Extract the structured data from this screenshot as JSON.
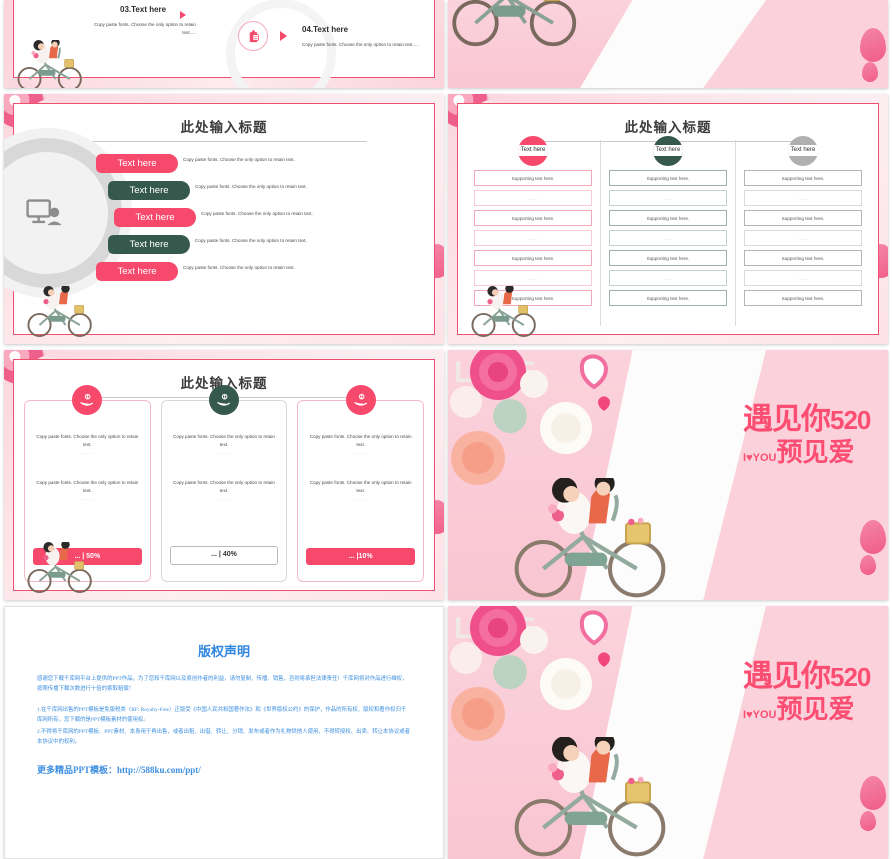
{
  "deck": {
    "theme_colors": {
      "pink": "#f7496c",
      "pink_light": "#fbd3dc",
      "green": "#35594c",
      "grey": "#b0b0b0",
      "text": "#3d3d3d",
      "copyright_blue": "#3d8fe0"
    },
    "slide_title": "此处输入标题",
    "body_text": "Copy paste fonts.  Choose the only option to retain text.",
    "ellipsis": "......"
  },
  "slide_top_left": {
    "items": [
      {
        "number_title": "03.Text here",
        "body": "Copy paste fonts.  Choose the only option to retain text....."
      },
      {
        "number_title": "04.Text here",
        "body": "Copy paste fonts.  Choose the only option to retain text....."
      }
    ],
    "icon": "gift-icon"
  },
  "slide_pills": {
    "title": "此处输入标题",
    "center_icon": "monitor-user-icon",
    "rows": [
      {
        "label": "Text here",
        "color": "pink",
        "body": "Copy paste fonts.  Choose the only option to retain text."
      },
      {
        "label": "Text here",
        "color": "green",
        "body": "Copy paste fonts.  Choose the only option to retain text."
      },
      {
        "label": "Text here",
        "color": "pink",
        "body": "Copy paste fonts.  Choose the only option to retain text."
      },
      {
        "label": "Text here",
        "color": "green",
        "body": "Copy paste fonts.  Choose the only option to retain text."
      },
      {
        "label": "Text here",
        "color": "pink",
        "body": "Copy paste fonts.  Choose the only option to retain text."
      }
    ]
  },
  "slide_table": {
    "title": "此处输入标题",
    "columns": [
      {
        "header": "Text here",
        "color": "#f7496c",
        "cells": [
          "Supporting text here.",
          "......",
          "Supporting text here.",
          "......",
          "Supporting text here.",
          "......",
          "Supporting text here."
        ]
      },
      {
        "header": "Text here",
        "color": "#35594c",
        "cells": [
          "Supporting text here.",
          "......",
          "Supporting text here.",
          "......",
          "Supporting text here.",
          "......",
          "Supporting text here."
        ]
      },
      {
        "header": "Text here",
        "color": "#b0b0b0",
        "cells": [
          "Supporting text here.",
          "......",
          "Supporting text here.",
          "......",
          "Supporting text here.",
          "......",
          "Supporting text here."
        ]
      }
    ]
  },
  "slide_cards": {
    "title": "此处输入标题",
    "cards": [
      {
        "icon": "hand-coins-icon",
        "icon_color": "#f7496c",
        "body1": "Copy paste fonts.  Choose the only option to retain text.",
        "dots1": "......",
        "body2": "Copy paste fonts.  Choose the only option to retain text.",
        "dots2": "......",
        "button": "... | 50%",
        "button_style": "filled"
      },
      {
        "icon": "hand-coins-icon",
        "icon_color": "#35594c",
        "body1": "Copy paste fonts.  Choose the only option to retain text.",
        "dots1": "......",
        "body2": "Copy paste fonts.  Choose the only option to retain text.",
        "dots2": "......",
        "button": "... | 40%",
        "button_style": "outline"
      },
      {
        "icon": "hand-coins-icon",
        "icon_color": "#f7496c",
        "body1": "Copy paste fonts.  Choose the only option to retain text.",
        "dots1": "......",
        "body2": "Copy paste fonts.  Choose the only option to retain text.",
        "dots2": "......",
        "button": "... |10%",
        "button_style": "filled"
      }
    ]
  },
  "slide_cover": {
    "line1": "遇见你",
    "number": "520",
    "i": "I",
    "heart": "♥",
    "you": "YOU",
    "line2": "预见爱",
    "decor_word": "LOVE"
  },
  "slide_copyright": {
    "title": "版权声明",
    "para1": "感谢您下载千库网平台上提供的PPT作品，为了您和千库网以及原创作者的利益，请勿复制、传播、销售，否则将承担法律责任！千库网将对作品进行维权，按照传播下载次数进行十倍的索取赔偿！",
    "item1": "1.在千库网出售的PPT模板是免版税类（RF: Royalty-Free）正版受《中国人民共和国著作法》和《世界版权公约》的保护，作品的所有权、版权和著作权归千库网所有，您下载的是PPT模板素材的使用权。",
    "item2": "2.不得将千库网的PPT模板、PPT素材、本身用于再出售，或者出租、出借、转让、分销、发布或者作为礼物供他人使用，不得转授权、出卖、转让本协议或者本协议中的权利。",
    "url_label": "更多精品PPT模板：",
    "url": "http://588ku.com/ppt/"
  }
}
